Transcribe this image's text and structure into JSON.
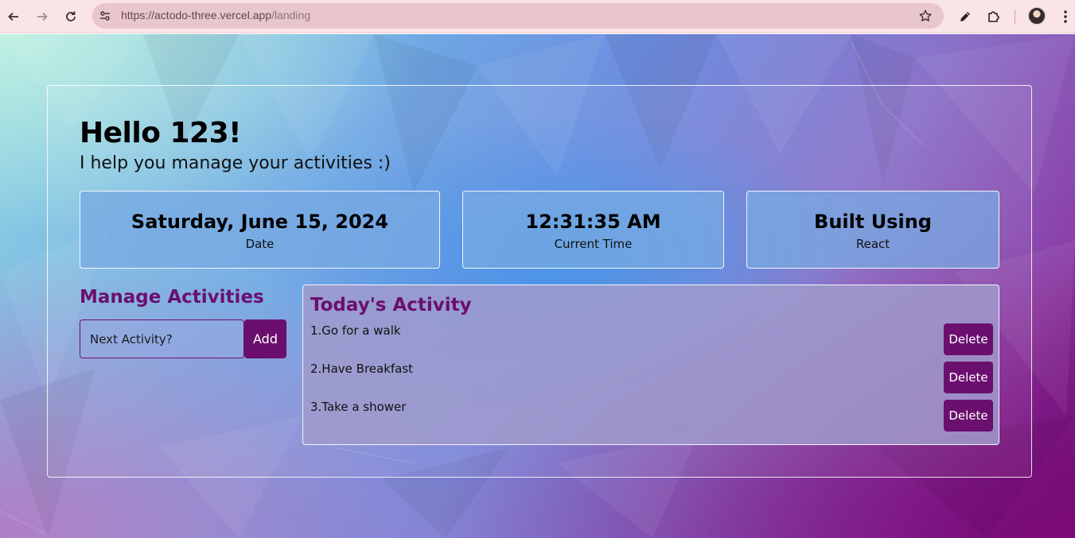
{
  "browser": {
    "url_host": "https://actodo-three.vercel.app",
    "url_path": "/landing"
  },
  "greeting": "Hello 123!",
  "tagline": "I help you manage your activities :)",
  "info_cards": [
    {
      "value": "Saturday, June 15, 2024",
      "label": "Date"
    },
    {
      "value": "12:31:35 AM",
      "label": "Current Time"
    },
    {
      "value": "Built Using",
      "label": "React"
    }
  ],
  "manage": {
    "title": "Manage Activities",
    "input_placeholder": "Next Activity?",
    "add_label": "Add"
  },
  "today": {
    "title": "Today's Activity",
    "delete_label": "Delete",
    "activities": [
      "1.Go for a walk",
      "2.Have Breakfast",
      "3.Take a shower"
    ]
  },
  "colors": {
    "accent": "#6b0f6e",
    "chrome_bg": "#fbe4e8",
    "omnibox_bg": "#e8c6cc"
  },
  "icons": [
    "back-icon",
    "forward-icon",
    "reload-icon",
    "site-info-icon",
    "star-icon",
    "pen-icon",
    "extensions-icon",
    "avatar",
    "menu-icon"
  ]
}
